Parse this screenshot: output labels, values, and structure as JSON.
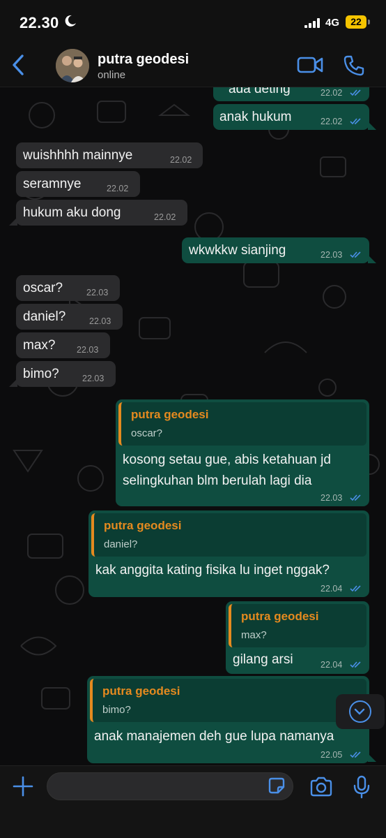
{
  "status_bar": {
    "time": "22.30",
    "network": "4G",
    "battery": "22"
  },
  "header": {
    "contact_name": "putra geodesi",
    "contact_status": "online"
  },
  "messages": [
    {
      "dir": "out",
      "text": "ada deting",
      "time": "22.02"
    },
    {
      "dir": "out",
      "text": "anak hukum",
      "time": "22.02"
    },
    {
      "dir": "in",
      "text": "wuishhhh mainnye",
      "time": "22.02"
    },
    {
      "dir": "in",
      "text": "seramnye",
      "time": "22.02"
    },
    {
      "dir": "in",
      "text": "hukum aku dong",
      "time": "22.02"
    },
    {
      "dir": "out",
      "text": "wkwkkw sianjing",
      "time": "22.03"
    },
    {
      "dir": "in",
      "text": "oscar?",
      "time": "22.03"
    },
    {
      "dir": "in",
      "text": "daniel?",
      "time": "22.03"
    },
    {
      "dir": "in",
      "text": "max?",
      "time": "22.03"
    },
    {
      "dir": "in",
      "text": "bimo?",
      "time": "22.03"
    },
    {
      "dir": "out",
      "reply_name": "putra geodesi",
      "reply_text": "oscar?",
      "lines": [
        "kosong setau gue, abis ketahuan jd",
        "selingkuhan blm berulah lagi dia"
      ],
      "time": "22.03"
    },
    {
      "dir": "out",
      "reply_name": "putra geodesi",
      "reply_text": "daniel?",
      "text": "kak anggita kating fisika lu inget nggak?",
      "time": "22.04"
    },
    {
      "dir": "out",
      "reply_name": "putra geodesi",
      "reply_text": "max?",
      "text": "gilang arsi",
      "time": "22.04"
    },
    {
      "dir": "out",
      "reply_name": "putra geodesi",
      "reply_text": "bimo?",
      "text": "anak manajemen deh gue lupa namanya",
      "time": "22.05"
    }
  ],
  "colors": {
    "accent": "#4a8fe7",
    "outgoing": "#0f4d40",
    "incoming": "#2b2b2d",
    "reply_name": "#e58a1f"
  },
  "icons": [
    "back-chevron-icon",
    "video-call-icon",
    "phone-icon",
    "plus-icon",
    "sticker-icon",
    "camera-icon",
    "mic-icon",
    "chevron-down-icon"
  ]
}
